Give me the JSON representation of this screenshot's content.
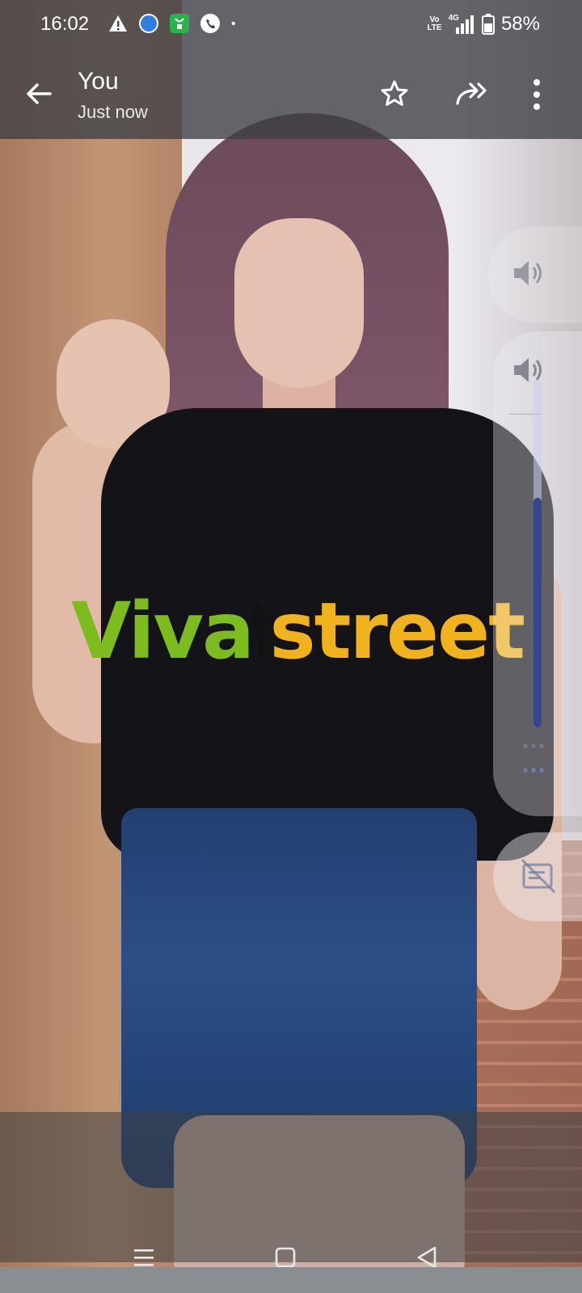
{
  "status_bar": {
    "time": "16:02",
    "battery": "58%",
    "network_type": "4G",
    "volte": [
      "Vo",
      "LTE"
    ],
    "notification_icons": [
      "warning-icon",
      "browser-icon",
      "app-store-icon",
      "messenger-icon",
      "more-notifications-dot"
    ]
  },
  "app_bar": {
    "title": "You",
    "subtitle": "Just now",
    "actions": [
      "star-icon",
      "forward-icon",
      "more-vert-icon"
    ]
  },
  "watermark": {
    "part1": "Viva",
    "part2": "street",
    "colors": {
      "viva": "#7cbc1f",
      "street": "#f0b31d"
    }
  },
  "volume_panel": {
    "level": 0.66,
    "accent": "#33478a"
  },
  "nav_bar": {
    "buttons": [
      "recents-icon",
      "home-icon",
      "back-icon"
    ]
  }
}
